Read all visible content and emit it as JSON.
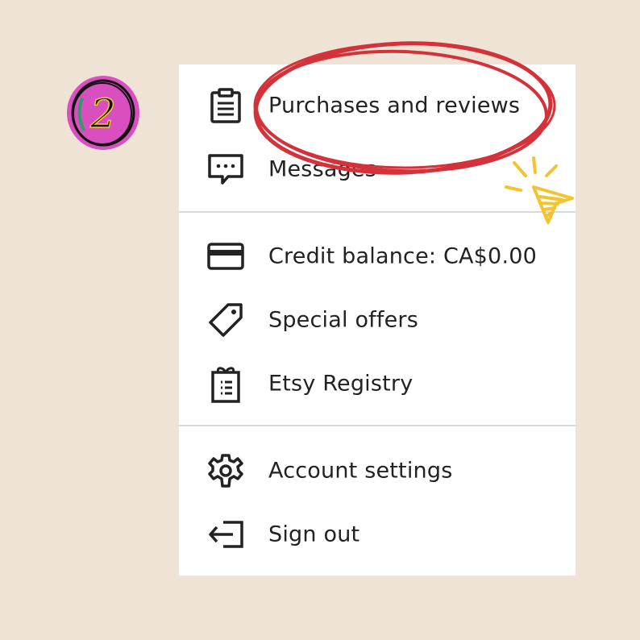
{
  "badge": {
    "step_number": "2"
  },
  "menu": {
    "section1": [
      {
        "label": "Purchases and reviews",
        "icon": "clipboard-icon"
      },
      {
        "label": "Messages",
        "icon": "message-icon"
      }
    ],
    "section2": [
      {
        "label": "Credit balance: CA$0.00",
        "icon": "credit-card-icon"
      },
      {
        "label": "Special offers",
        "icon": "tag-icon"
      },
      {
        "label": "Etsy Registry",
        "icon": "gift-list-icon"
      }
    ],
    "section3": [
      {
        "label": "Account settings",
        "icon": "gear-icon"
      },
      {
        "label": "Sign out",
        "icon": "sign-out-icon"
      }
    ]
  },
  "annotation": {
    "highlight_color": "#d3323a",
    "cursor_color": "#f2c530",
    "badge_fill": "#d94fc0"
  }
}
